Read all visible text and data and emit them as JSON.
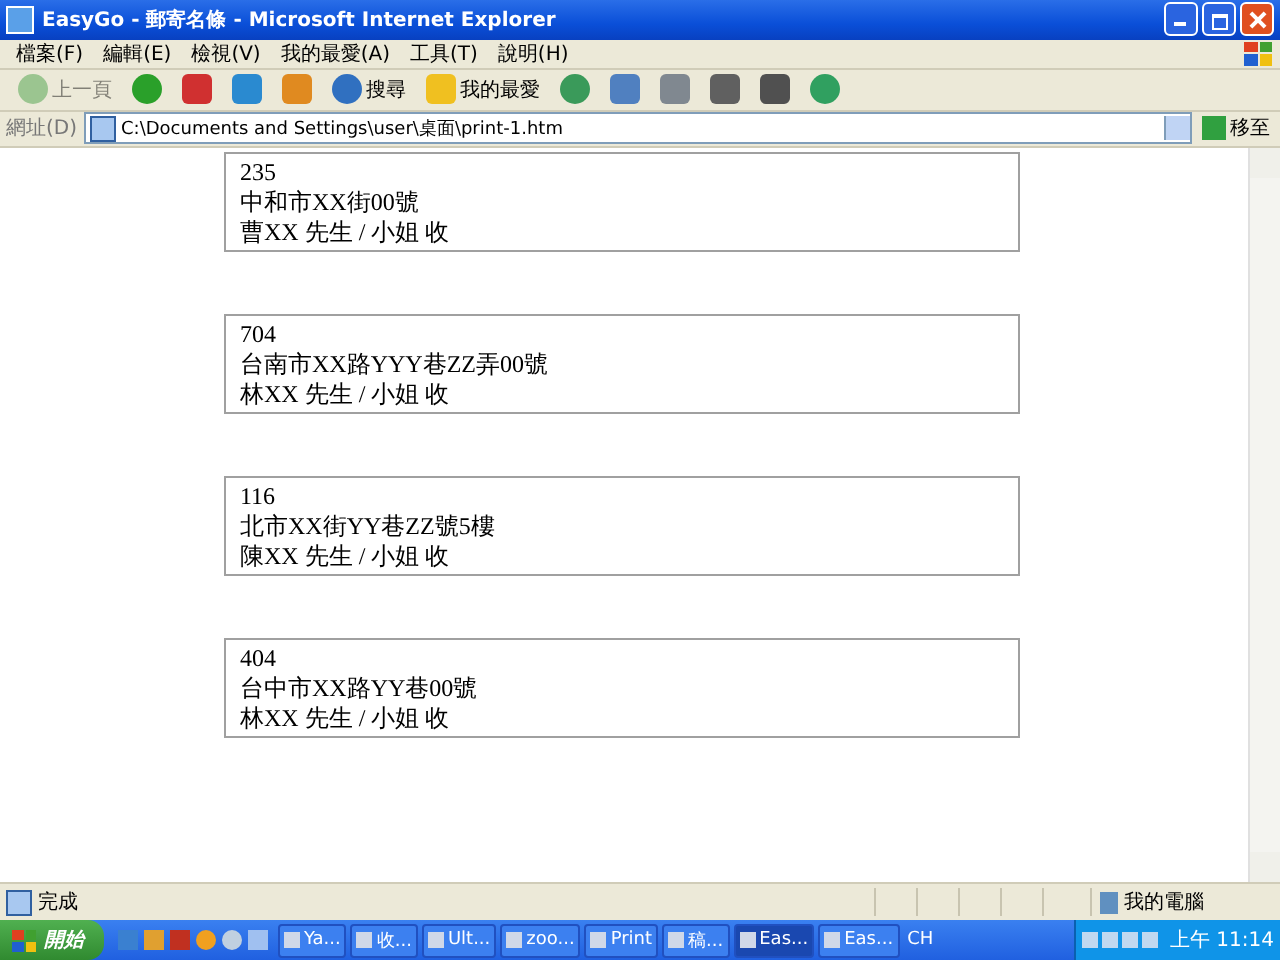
{
  "window": {
    "title": "EasyGo - 郵寄名條 - Microsoft Internet Explorer"
  },
  "menu": [
    "檔案(F)",
    "編輯(E)",
    "檢視(V)",
    "我的最愛(A)",
    "工具(T)",
    "說明(H)"
  ],
  "toolbar": [
    {
      "kind": "back",
      "label": "上一頁",
      "disabled": true
    },
    {
      "kind": "forward",
      "disabled": false
    },
    {
      "kind": "stop",
      "disabled": false
    },
    {
      "kind": "refresh",
      "disabled": false
    },
    {
      "kind": "home",
      "disabled": false
    },
    {
      "kind": "search",
      "label": "搜尋",
      "disabled": false
    },
    {
      "kind": "favorites",
      "label": "我的最愛",
      "disabled": false
    },
    {
      "kind": "history",
      "disabled": false
    },
    {
      "kind": "mail",
      "disabled": false
    },
    {
      "kind": "print",
      "disabled": false
    },
    {
      "kind": "edit",
      "disabled": false
    },
    {
      "kind": "discuss",
      "disabled": false
    },
    {
      "kind": "messenger",
      "disabled": false
    }
  ],
  "address": {
    "label": "網址(D)",
    "value": "C:\\Documents and Settings\\user\\桌面\\print-1.htm",
    "go": "移至"
  },
  "labels": [
    {
      "zip": "235",
      "address": "中和市XX街00號",
      "recipient": "曹XX 先生 / 小姐 收"
    },
    {
      "zip": "704",
      "address": "台南市XX路YYY巷ZZ弄00號",
      "recipient": "林XX 先生 / 小姐 收"
    },
    {
      "zip": "116",
      "address": "北市XX街YY巷ZZ號5樓",
      "recipient": "陳XX 先生 / 小姐 收"
    },
    {
      "zip": "404",
      "address": "台中市XX路YY巷00號",
      "recipient": "林XX 先生 / 小姐 收"
    }
  ],
  "status_bar": {
    "text": "完成",
    "zone": "我的電腦"
  },
  "taskbar": {
    "start": "開始",
    "tasks": [
      {
        "label": "Ya...",
        "selected": false
      },
      {
        "label": "收...",
        "selected": false
      },
      {
        "label": "Ult...",
        "selected": false
      },
      {
        "label": "zoo...",
        "selected": false
      },
      {
        "label": "Print",
        "selected": false
      },
      {
        "label": "稿...",
        "selected": false
      },
      {
        "label": "Eas...",
        "selected": true
      },
      {
        "label": "Eas...",
        "selected": false
      }
    ],
    "lang": "CH",
    "clock": "上午 11:14"
  }
}
